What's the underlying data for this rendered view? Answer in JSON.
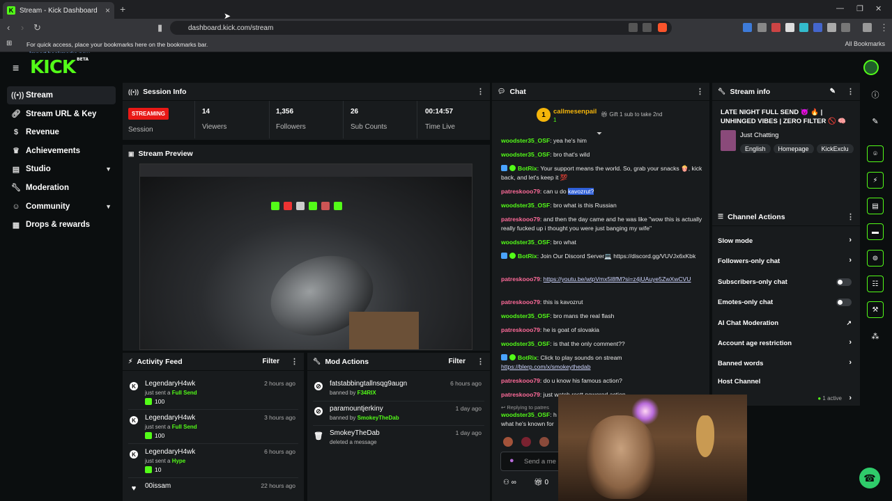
{
  "browser": {
    "tab_title": "Stream - Kick Dashboard",
    "tab_favicon": "K",
    "url": "dashboard.kick.com/stream",
    "bookmark_msg": "For quick access, place your bookmarks here on the bookmarks bar.",
    "bookmark_link": "Import bookmarks now...",
    "all_bookmarks": "All Bookmarks"
  },
  "app": {
    "logo": "KICK",
    "logo_badge": "BETA",
    "accent": "#53fc18"
  },
  "sidebar": {
    "items": [
      {
        "label": "Stream",
        "icon": "broadcast-icon"
      },
      {
        "label": "Stream URL & Key",
        "icon": "link-icon"
      },
      {
        "label": "Revenue",
        "icon": "dollar-icon"
      },
      {
        "label": "Achievements",
        "icon": "trophy-icon"
      },
      {
        "label": "Studio",
        "icon": "studio-icon"
      },
      {
        "label": "Moderation",
        "icon": "wrench-icon"
      },
      {
        "label": "Community",
        "icon": "community-icon"
      },
      {
        "label": "Drops & rewards",
        "icon": "gift-icon"
      }
    ]
  },
  "session": {
    "title": "Session Info",
    "badge": "STREAMING",
    "badge_label": "Session",
    "viewers": "14",
    "viewers_label": "Viewers",
    "followers": "1,356",
    "followers_label": "Followers",
    "subs": "26",
    "subs_label": "Sub Counts",
    "time": "00:14:57",
    "time_label": "Time Live"
  },
  "preview": {
    "title": "Stream Preview"
  },
  "activity": {
    "title": "Activity Feed",
    "filter": "Filter",
    "items": [
      {
        "name": "LegendaryH4wk",
        "action": "just sent a ",
        "item": "Full Send",
        "amount": "100",
        "time": "2 hours ago"
      },
      {
        "name": "LegendaryH4wk",
        "action": "just sent a ",
        "item": "Full Send",
        "amount": "100",
        "time": "3 hours ago"
      },
      {
        "name": "LegendaryH4wk",
        "action": "just sent a ",
        "item": "Hype",
        "amount": "10",
        "time": "6 hours ago"
      },
      {
        "name": "00issam",
        "time": "22 hours ago"
      }
    ]
  },
  "modactions": {
    "title": "Mod Actions",
    "filter": "Filter",
    "items": [
      {
        "name": "fatstabbingtallnsqg9augn",
        "action": "banned by ",
        "by": "F34RIX",
        "time": "6 hours ago"
      },
      {
        "name": "paramountjerkiny",
        "action": "banned by ",
        "by": "SmokeyTheDab",
        "time": "1 day ago"
      },
      {
        "name": "SmokeyTheDab",
        "action": "deleted a message",
        "by": "",
        "time": "1 day ago"
      }
    ]
  },
  "chat": {
    "title": "Chat",
    "top_gifter": "callmesenpail",
    "top_gifter_count": "1",
    "top_rank": "1",
    "gift_hint": "Gift 1 sub to take 2nd",
    "messages": [
      {
        "user": "woodster35_OSF",
        "text": ": yea he's him"
      },
      {
        "user": "woodster35_OSF",
        "text": ": bro that's wild"
      },
      {
        "user": "BotRix",
        "text": ": Your support means the world. So, grab your snacks 🍿, kick back, and let's keep it 💯"
      },
      {
        "user": "patreskooo79",
        "text": ": can u do ",
        "hl": "kavozrut?"
      },
      {
        "user": "woodster35_OSF",
        "text": ": bro what is this Russian"
      },
      {
        "user": "patreskooo79",
        "text": ": and then the day came and he was like \"wow this is actually really fucked up i thought you were just banging my wife\""
      },
      {
        "user": "woodster35_OSF",
        "text": ": bro what"
      },
      {
        "user": "BotRix",
        "text": ": Join Our Discord Server💻 ",
        "link": "https://discord.gg/VUVJx6xKbk"
      },
      {
        "user": "patreskooo79",
        "text": ": ",
        "link": "https://youtu.be/wtpVmx5l8fM?si=z4jUAuye5ZwXwCVU"
      },
      {
        "user": "patreskooo79",
        "text": ": this is kavozrut"
      },
      {
        "user": "woodster35_OSF",
        "text": ": bro mans the real flash"
      },
      {
        "user": "patreskooo79",
        "text": ": he is goat of slovakia"
      },
      {
        "user": "woodster35_OSF",
        "text": ": is that the only comment??"
      },
      {
        "user": "BotRix",
        "text": ": Click to play sounds on stream ",
        "link": "https://blerp.com/x/smokeythedab"
      },
      {
        "user": "patreskooo79",
        "text": ": do u know his famous action?"
      },
      {
        "user": "patreskooo79",
        "text": ": just watch restt powered action"
      }
    ],
    "reply_hint": "Replying to patres",
    "partial_user": "woodster35_OSF",
    "partial_text": ": h",
    "partial_line2": "what he's known for",
    "send_placeholder": "Send a me",
    "footer_count": "0"
  },
  "stream_info": {
    "title": "Stream info",
    "stream_title": "LATE NIGHT FULL SEND 😈 🔥 | UNHINGED VIBES | ZERO FILTER 🚫 🧠",
    "category": "Just Chatting",
    "tags": [
      "English",
      "Homepage",
      "KickExclu"
    ]
  },
  "channel_actions": {
    "title": "Channel Actions",
    "rows": [
      {
        "label": "Slow mode",
        "kind": "arrow"
      },
      {
        "label": "Followers-only chat",
        "kind": "arrow"
      },
      {
        "label": "Subscribers-only chat",
        "kind": "toggle"
      },
      {
        "label": "Emotes-only chat",
        "kind": "toggle"
      },
      {
        "label": "AI Chat Moderation",
        "kind": "ext"
      },
      {
        "label": "Account age restriction",
        "kind": "arrow"
      },
      {
        "label": "Banned words",
        "kind": "arrow"
      },
      {
        "label": "Host Channel",
        "kind": "none"
      }
    ],
    "active": "1 active"
  }
}
